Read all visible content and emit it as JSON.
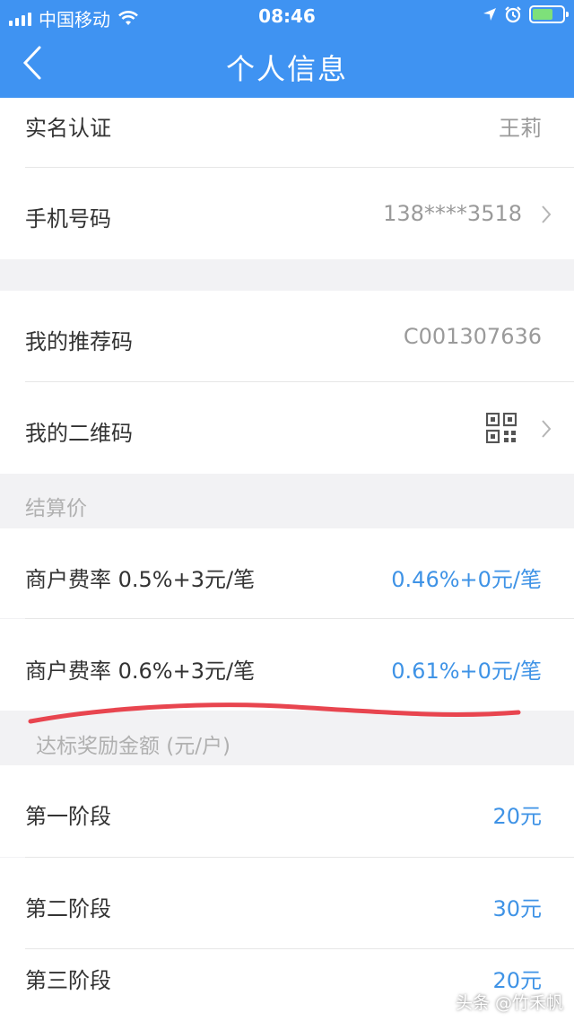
{
  "status_bar": {
    "carrier": "中国移动",
    "time": "08:46"
  },
  "nav": {
    "title": "个人信息"
  },
  "profile": {
    "real_name_label": "实名认证",
    "real_name_value": "王莉",
    "phone_label": "手机号码",
    "phone_value": "138****3518"
  },
  "referral": {
    "code_label": "我的推荐码",
    "code_value": "C001307636",
    "qr_label": "我的二维码"
  },
  "settlement": {
    "section_title": "结算价",
    "rows": [
      {
        "label": "商户费率 0.5%+3元/笔",
        "value": "0.46%+0元/笔"
      },
      {
        "label": "商户费率 0.6%+3元/笔",
        "value": "0.61%+0元/笔"
      }
    ]
  },
  "rewards": {
    "section_title": "达标奖励金额 (元/户)",
    "rows": [
      {
        "label": "第一阶段",
        "value": "20元"
      },
      {
        "label": "第二阶段",
        "value": "30元"
      },
      {
        "label": "第三阶段",
        "value": "20元"
      }
    ]
  },
  "watermark": "头条 @竹禾帆",
  "colors": {
    "header": "#3f93f2",
    "value_blue": "#3f93e6",
    "annotation_red": "#e8454f"
  }
}
